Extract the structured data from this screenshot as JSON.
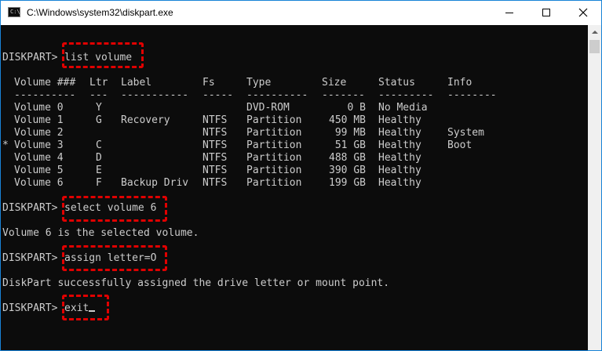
{
  "window": {
    "title": "C:\\Windows\\system32\\diskpart.exe",
    "icon": "cmd-icon",
    "controls": [
      "minimize-icon",
      "maximize-icon",
      "close-icon"
    ]
  },
  "console": {
    "cmd1": {
      "prompt": "DISKPART> ",
      "command": "list volume"
    },
    "table": {
      "headers": [
        "Volume ###",
        "Ltr",
        "Label",
        "Fs",
        "Type",
        "Size",
        "Status",
        "Info"
      ],
      "separators": [
        "----------",
        "---",
        "-----------",
        "-----",
        "----------",
        "-------",
        "---------",
        "--------"
      ],
      "rows": [
        {
          "marker": "",
          "volume": "Volume 0",
          "ltr": "Y",
          "label": "",
          "fs": "",
          "type": "DVD-ROM",
          "size": "0 B",
          "status": "No Media",
          "info": ""
        },
        {
          "marker": "",
          "volume": "Volume 1",
          "ltr": "G",
          "label": "Recovery",
          "fs": "NTFS",
          "type": "Partition",
          "size": "450 MB",
          "status": "Healthy",
          "info": ""
        },
        {
          "marker": "",
          "volume": "Volume 2",
          "ltr": "",
          "label": "",
          "fs": "NTFS",
          "type": "Partition",
          "size": "99 MB",
          "status": "Healthy",
          "info": "System"
        },
        {
          "marker": "*",
          "volume": "Volume 3",
          "ltr": "C",
          "label": "",
          "fs": "NTFS",
          "type": "Partition",
          "size": "51 GB",
          "status": "Healthy",
          "info": "Boot"
        },
        {
          "marker": "",
          "volume": "Volume 4",
          "ltr": "D",
          "label": "",
          "fs": "NTFS",
          "type": "Partition",
          "size": "488 GB",
          "status": "Healthy",
          "info": ""
        },
        {
          "marker": "",
          "volume": "Volume 5",
          "ltr": "E",
          "label": "",
          "fs": "NTFS",
          "type": "Partition",
          "size": "390 GB",
          "status": "Healthy",
          "info": ""
        },
        {
          "marker": "",
          "volume": "Volume 6",
          "ltr": "F",
          "label": "Backup Driv",
          "fs": "NTFS",
          "type": "Partition",
          "size": "199 GB",
          "status": "Healthy",
          "info": ""
        }
      ]
    },
    "cmd2": {
      "prompt": "DISKPART> ",
      "command": "select volume 6"
    },
    "output2": "Volume 6 is the selected volume.",
    "cmd3": {
      "prompt": "DISKPART> ",
      "command": "assign letter=O"
    },
    "output3": "DiskPart successfully assigned the drive letter or mount point.",
    "cmd4": {
      "prompt": "DISKPART> ",
      "command": "exit"
    },
    "highlight_color": "#e00000",
    "text_color": "#cccccc",
    "background_color": "#0c0c0c"
  }
}
